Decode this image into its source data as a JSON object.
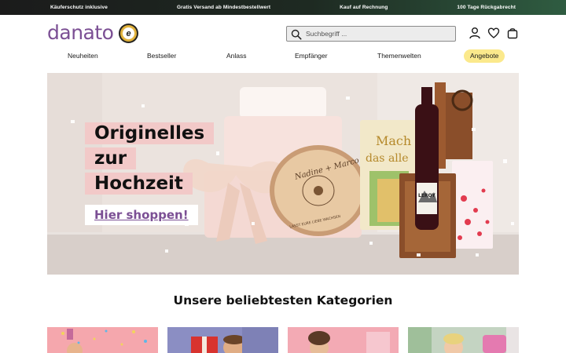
{
  "promo": {
    "items": [
      "Käuferschutz inklusive",
      "Gratis Versand ab Mindestbestellwert",
      "Kauf auf Rechnung",
      "100 Tage Rückgabrecht"
    ]
  },
  "header": {
    "logo": "danato",
    "trust_badge": "e",
    "search_placeholder": "Suchbegriff ...",
    "icons": [
      "user-icon",
      "heart-icon",
      "bag-icon"
    ]
  },
  "nav": {
    "items": [
      "Neuheiten",
      "Bestseller",
      "Anlass",
      "Empfänger",
      "Themenwelten"
    ],
    "offer": "Angebote"
  },
  "hero": {
    "line1": "Originelles",
    "line2": "zur",
    "line3": "Hochzeit",
    "cta": "Hier shoppen!",
    "wood_disc_text": "Nadine + Marco",
    "wood_disc_subtext": "LASST EURE LIEBE WACHSEN",
    "card_text_1": "Mach",
    "card_text_2": "das alle",
    "bottle_label": "LEROY"
  },
  "categories": {
    "title": "Unsere beliebtesten Kategorien",
    "tiles": [
      "category-tile-party",
      "category-tile-gift-man",
      "category-tile-woman",
      "category-tile-kids"
    ]
  },
  "colors": {
    "brand": "#7b4f94",
    "promo_bg": "#1e2a22",
    "offer_bg": "#fbe98c",
    "hero_text_bg": "#f2c9c8"
  }
}
